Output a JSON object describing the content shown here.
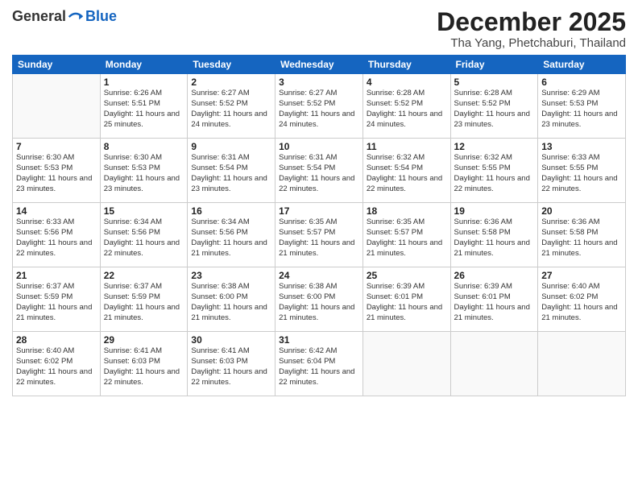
{
  "logo": {
    "general": "General",
    "blue": "Blue"
  },
  "title": "December 2025",
  "location": "Tha Yang, Phetchaburi, Thailand",
  "days_of_week": [
    "Sunday",
    "Monday",
    "Tuesday",
    "Wednesday",
    "Thursday",
    "Friday",
    "Saturday"
  ],
  "weeks": [
    [
      {
        "day": "",
        "empty": true
      },
      {
        "day": "1",
        "sunrise": "Sunrise: 6:26 AM",
        "sunset": "Sunset: 5:51 PM",
        "daylight": "Daylight: 11 hours and 25 minutes."
      },
      {
        "day": "2",
        "sunrise": "Sunrise: 6:27 AM",
        "sunset": "Sunset: 5:52 PM",
        "daylight": "Daylight: 11 hours and 24 minutes."
      },
      {
        "day": "3",
        "sunrise": "Sunrise: 6:27 AM",
        "sunset": "Sunset: 5:52 PM",
        "daylight": "Daylight: 11 hours and 24 minutes."
      },
      {
        "day": "4",
        "sunrise": "Sunrise: 6:28 AM",
        "sunset": "Sunset: 5:52 PM",
        "daylight": "Daylight: 11 hours and 24 minutes."
      },
      {
        "day": "5",
        "sunrise": "Sunrise: 6:28 AM",
        "sunset": "Sunset: 5:52 PM",
        "daylight": "Daylight: 11 hours and 23 minutes."
      },
      {
        "day": "6",
        "sunrise": "Sunrise: 6:29 AM",
        "sunset": "Sunset: 5:53 PM",
        "daylight": "Daylight: 11 hours and 23 minutes."
      }
    ],
    [
      {
        "day": "7",
        "sunrise": "Sunrise: 6:30 AM",
        "sunset": "Sunset: 5:53 PM",
        "daylight": "Daylight: 11 hours and 23 minutes."
      },
      {
        "day": "8",
        "sunrise": "Sunrise: 6:30 AM",
        "sunset": "Sunset: 5:53 PM",
        "daylight": "Daylight: 11 hours and 23 minutes."
      },
      {
        "day": "9",
        "sunrise": "Sunrise: 6:31 AM",
        "sunset": "Sunset: 5:54 PM",
        "daylight": "Daylight: 11 hours and 23 minutes."
      },
      {
        "day": "10",
        "sunrise": "Sunrise: 6:31 AM",
        "sunset": "Sunset: 5:54 PM",
        "daylight": "Daylight: 11 hours and 22 minutes."
      },
      {
        "day": "11",
        "sunrise": "Sunrise: 6:32 AM",
        "sunset": "Sunset: 5:54 PM",
        "daylight": "Daylight: 11 hours and 22 minutes."
      },
      {
        "day": "12",
        "sunrise": "Sunrise: 6:32 AM",
        "sunset": "Sunset: 5:55 PM",
        "daylight": "Daylight: 11 hours and 22 minutes."
      },
      {
        "day": "13",
        "sunrise": "Sunrise: 6:33 AM",
        "sunset": "Sunset: 5:55 PM",
        "daylight": "Daylight: 11 hours and 22 minutes."
      }
    ],
    [
      {
        "day": "14",
        "sunrise": "Sunrise: 6:33 AM",
        "sunset": "Sunset: 5:56 PM",
        "daylight": "Daylight: 11 hours and 22 minutes."
      },
      {
        "day": "15",
        "sunrise": "Sunrise: 6:34 AM",
        "sunset": "Sunset: 5:56 PM",
        "daylight": "Daylight: 11 hours and 22 minutes."
      },
      {
        "day": "16",
        "sunrise": "Sunrise: 6:34 AM",
        "sunset": "Sunset: 5:56 PM",
        "daylight": "Daylight: 11 hours and 21 minutes."
      },
      {
        "day": "17",
        "sunrise": "Sunrise: 6:35 AM",
        "sunset": "Sunset: 5:57 PM",
        "daylight": "Daylight: 11 hours and 21 minutes."
      },
      {
        "day": "18",
        "sunrise": "Sunrise: 6:35 AM",
        "sunset": "Sunset: 5:57 PM",
        "daylight": "Daylight: 11 hours and 21 minutes."
      },
      {
        "day": "19",
        "sunrise": "Sunrise: 6:36 AM",
        "sunset": "Sunset: 5:58 PM",
        "daylight": "Daylight: 11 hours and 21 minutes."
      },
      {
        "day": "20",
        "sunrise": "Sunrise: 6:36 AM",
        "sunset": "Sunset: 5:58 PM",
        "daylight": "Daylight: 11 hours and 21 minutes."
      }
    ],
    [
      {
        "day": "21",
        "sunrise": "Sunrise: 6:37 AM",
        "sunset": "Sunset: 5:59 PM",
        "daylight": "Daylight: 11 hours and 21 minutes."
      },
      {
        "day": "22",
        "sunrise": "Sunrise: 6:37 AM",
        "sunset": "Sunset: 5:59 PM",
        "daylight": "Daylight: 11 hours and 21 minutes."
      },
      {
        "day": "23",
        "sunrise": "Sunrise: 6:38 AM",
        "sunset": "Sunset: 6:00 PM",
        "daylight": "Daylight: 11 hours and 21 minutes."
      },
      {
        "day": "24",
        "sunrise": "Sunrise: 6:38 AM",
        "sunset": "Sunset: 6:00 PM",
        "daylight": "Daylight: 11 hours and 21 minutes."
      },
      {
        "day": "25",
        "sunrise": "Sunrise: 6:39 AM",
        "sunset": "Sunset: 6:01 PM",
        "daylight": "Daylight: 11 hours and 21 minutes."
      },
      {
        "day": "26",
        "sunrise": "Sunrise: 6:39 AM",
        "sunset": "Sunset: 6:01 PM",
        "daylight": "Daylight: 11 hours and 21 minutes."
      },
      {
        "day": "27",
        "sunrise": "Sunrise: 6:40 AM",
        "sunset": "Sunset: 6:02 PM",
        "daylight": "Daylight: 11 hours and 21 minutes."
      }
    ],
    [
      {
        "day": "28",
        "sunrise": "Sunrise: 6:40 AM",
        "sunset": "Sunset: 6:02 PM",
        "daylight": "Daylight: 11 hours and 22 minutes."
      },
      {
        "day": "29",
        "sunrise": "Sunrise: 6:41 AM",
        "sunset": "Sunset: 6:03 PM",
        "daylight": "Daylight: 11 hours and 22 minutes."
      },
      {
        "day": "30",
        "sunrise": "Sunrise: 6:41 AM",
        "sunset": "Sunset: 6:03 PM",
        "daylight": "Daylight: 11 hours and 22 minutes."
      },
      {
        "day": "31",
        "sunrise": "Sunrise: 6:42 AM",
        "sunset": "Sunset: 6:04 PM",
        "daylight": "Daylight: 11 hours and 22 minutes."
      },
      {
        "day": "",
        "empty": true
      },
      {
        "day": "",
        "empty": true
      },
      {
        "day": "",
        "empty": true
      }
    ]
  ]
}
